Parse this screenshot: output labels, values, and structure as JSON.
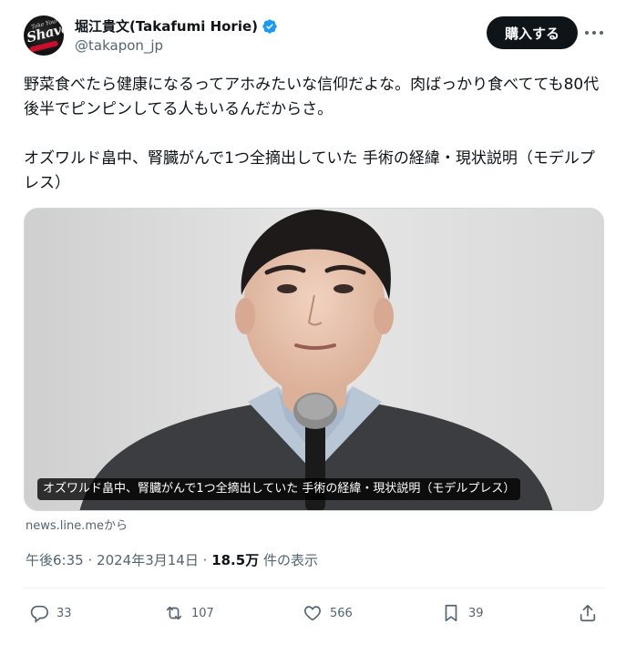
{
  "user": {
    "display_name": "堀江貴文(Takafumi Horie)",
    "handle": "@takapon_jp",
    "avatar_icon": "shave-logo-avatar",
    "avatar_top_text": "Take Your",
    "avatar_logo_text": "Shave",
    "verified_icon": "verified-badge-icon",
    "verified_color": "#1d9bf0"
  },
  "header": {
    "buy_label": "購入する",
    "more_icon": "more-dots-icon"
  },
  "tweet": {
    "text": "野菜食べたら健康になるってアホみたいな信仰だよな。肉ばっかり食べてても80代後半でピンピンしてる人もいるんだからさ。\n\nオズワルド畠中、腎臓がんで1つ全摘出していた 手術の経緯・現状説明（モデルプレス）"
  },
  "media": {
    "caption": "オズワルド畠中、腎臓がんで1つ全摘出していた 手術の経緯・現状説明（モデルプレス）"
  },
  "source": {
    "text": "news.line.meから"
  },
  "meta": {
    "time": "午後6:35",
    "separator": "·",
    "date": "2024年3月14日",
    "views": "18.5万",
    "views_suffix": "件の表示"
  },
  "actions": {
    "reply": {
      "icon": "reply-icon",
      "count": "33"
    },
    "retweet": {
      "icon": "retweet-icon",
      "count": "107"
    },
    "like": {
      "icon": "like-icon",
      "count": "566"
    },
    "bookmark": {
      "icon": "bookmark-icon",
      "count": "39"
    },
    "share": {
      "icon": "share-icon"
    }
  },
  "colors": {
    "text_primary": "#0f1419",
    "text_secondary": "#536471",
    "button_bg": "#0f1419"
  }
}
